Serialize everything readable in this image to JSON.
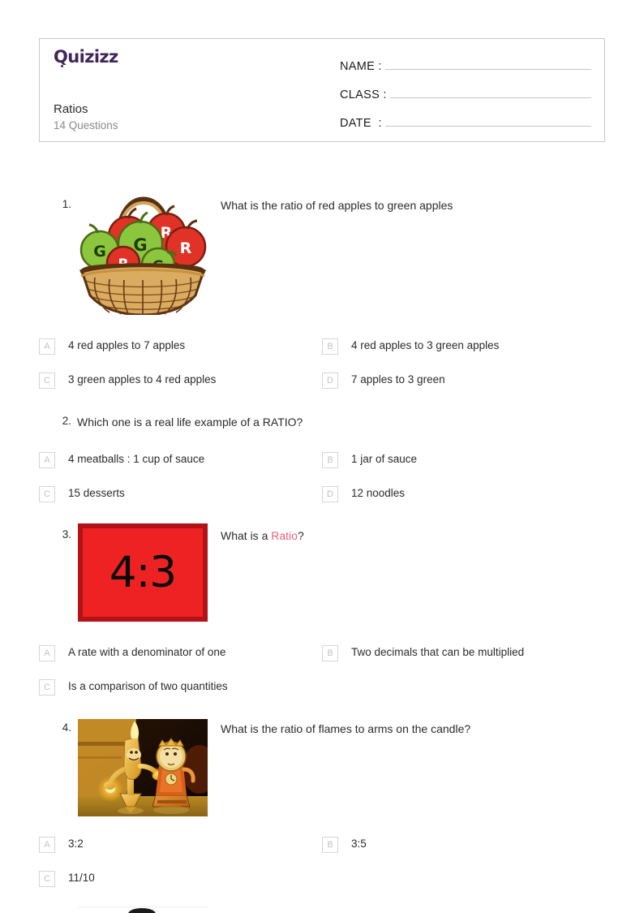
{
  "header": {
    "logo_text": "Quizizz",
    "logo_color": "#41265a",
    "title": "Ratios",
    "subtitle": "14 Questions",
    "fields": [
      {
        "label": "NAME :"
      },
      {
        "label": "CLASS :"
      },
      {
        "label": "DATE  :"
      }
    ]
  },
  "accent_color": "#e8617d",
  "questions": [
    {
      "number": "1.",
      "text": "What is the ratio of red apples to green apples",
      "has_image": true,
      "image": "apple-basket-illustration",
      "options": [
        {
          "badge": "A",
          "text": "4 red apples to 7 apples"
        },
        {
          "badge": "B",
          "text": "4 red apples to 3 green apples"
        },
        {
          "badge": "C",
          "text": "3 green apples to 4 red apples"
        },
        {
          "badge": "D",
          "text": "7 apples to 3 green"
        }
      ]
    },
    {
      "number": "2.",
      "text": "Which one is a real life example of a RATIO?",
      "has_image": false,
      "options": [
        {
          "badge": "A",
          "text": "4 meatballs : 1 cup of sauce"
        },
        {
          "badge": "B",
          "text": "1 jar of sauce"
        },
        {
          "badge": "C",
          "text": "15 desserts"
        },
        {
          "badge": "D",
          "text": "12 noodles"
        }
      ]
    },
    {
      "number": "3.",
      "text_before": "What is a ",
      "text_accent": "Ratio",
      "text_after": "?",
      "has_image": true,
      "image": "ratio-4-3-tile",
      "image_text": "4:3",
      "options": [
        {
          "badge": "A",
          "text": "A rate with a denominator of one"
        },
        {
          "badge": "B",
          "text": "Two decimals that can be multiplied"
        },
        {
          "badge": "C",
          "text": "Is a comparison of two quantities"
        }
      ]
    },
    {
      "number": "4.",
      "text": "What is the ratio of flames to arms on the candle?",
      "has_image": true,
      "image": "candelabra-photo",
      "options": [
        {
          "badge": "A",
          "text": "3:2"
        },
        {
          "badge": "B",
          "text": "3:5"
        },
        {
          "badge": "C",
          "text": "11/10"
        }
      ]
    }
  ],
  "apple_labels": {
    "red": "R",
    "green": "G",
    "red_count": 4,
    "green_count": 3
  }
}
